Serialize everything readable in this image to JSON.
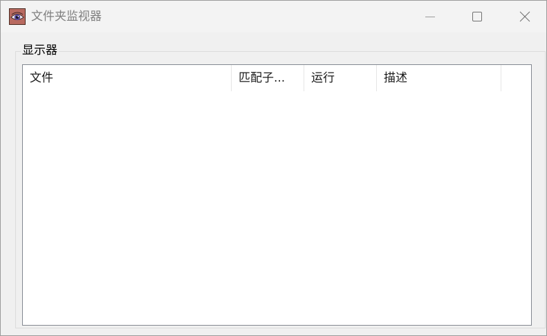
{
  "window": {
    "title": "文件夹监视器",
    "icon": "eye-icon",
    "controls": {
      "minimize_icon": "minimize-icon",
      "maximize_icon": "maximize-icon",
      "close_icon": "close-icon"
    }
  },
  "groupbox": {
    "label": "显示器"
  },
  "listview": {
    "columns": [
      "文件",
      "匹配子...",
      "运行",
      "描述"
    ],
    "rows": []
  },
  "colors": {
    "window_bg": "#f0f0f0",
    "titlebar_bg": "#f3f3f3",
    "title_text": "#808080",
    "list_border": "#828790",
    "list_bg": "#ffffff"
  }
}
